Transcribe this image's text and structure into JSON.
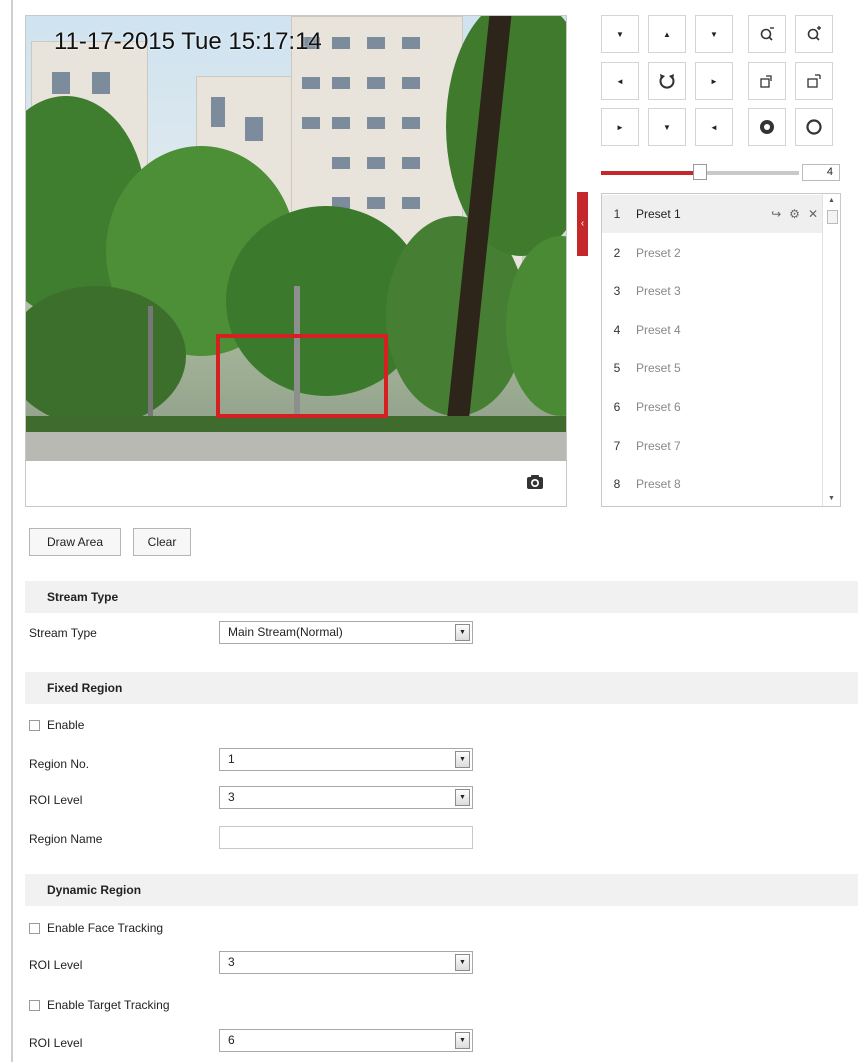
{
  "video": {
    "osd_text": "11-17-2015 Tue 15:17:14",
    "snapshot_icon": "camera-icon"
  },
  "ptz": {
    "buttons": [
      {
        "name": "pan-up-left-button",
        "icon": "arrow-up-left-icon",
        "glyph": "▼"
      },
      {
        "name": "pan-up-button",
        "icon": "arrow-up-icon",
        "glyph": "▲"
      },
      {
        "name": "pan-up-right-button",
        "icon": "arrow-up-right-icon",
        "glyph": "▼"
      },
      {
        "name": "zoom-out-button",
        "icon": "zoom-out-icon",
        "glyph": ""
      },
      {
        "name": "zoom-in-button",
        "icon": "zoom-in-icon",
        "glyph": ""
      },
      {
        "name": "pan-left-button",
        "icon": "arrow-left-icon",
        "glyph": "◄"
      },
      {
        "name": "auto-pan-button",
        "icon": "rotate-icon",
        "glyph": ""
      },
      {
        "name": "pan-right-button",
        "icon": "arrow-right-icon",
        "glyph": "►"
      },
      {
        "name": "focus-near-button",
        "icon": "focus-near-icon",
        "glyph": ""
      },
      {
        "name": "focus-far-button",
        "icon": "focus-far-icon",
        "glyph": ""
      },
      {
        "name": "pan-down-left-button",
        "icon": "arrow-down-left-icon",
        "glyph": "►"
      },
      {
        "name": "pan-down-button",
        "icon": "arrow-down-icon",
        "glyph": "▼"
      },
      {
        "name": "pan-down-right-button",
        "icon": "arrow-down-right-icon",
        "glyph": "◄"
      },
      {
        "name": "iris-open-button",
        "icon": "iris-open-icon",
        "glyph": ""
      },
      {
        "name": "iris-close-button",
        "icon": "iris-close-icon",
        "glyph": ""
      }
    ],
    "speed": {
      "value": "4",
      "level": 0.5
    }
  },
  "presets": {
    "items": [
      {
        "num": "1",
        "name": "Preset 1"
      },
      {
        "num": "2",
        "name": "Preset 2"
      },
      {
        "num": "3",
        "name": "Preset 3"
      },
      {
        "num": "4",
        "name": "Preset 4"
      },
      {
        "num": "5",
        "name": "Preset 5"
      },
      {
        "num": "6",
        "name": "Preset 6"
      },
      {
        "num": "7",
        "name": "Preset 7"
      },
      {
        "num": "8",
        "name": "Preset 8"
      }
    ],
    "active_actions": [
      "call-preset-icon",
      "gear-icon",
      "close-icon"
    ]
  },
  "roi_buttons": {
    "draw_area": "Draw Area",
    "clear": "Clear"
  },
  "stream_type": {
    "header": "Stream Type",
    "label": "Stream Type",
    "value": "Main Stream(Normal)"
  },
  "fixed_region": {
    "header": "Fixed Region",
    "enable_label": "Enable",
    "region_no_label": "Region No.",
    "region_no_value": "1",
    "roi_level_label": "ROI Level",
    "roi_level_value": "3",
    "region_name_label": "Region Name",
    "region_name_value": ""
  },
  "dynamic_region": {
    "header": "Dynamic Region",
    "face_tracking_label": "Enable Face Tracking",
    "face_roi_level_label": "ROI Level",
    "face_roi_level_value": "3",
    "target_tracking_label": "Enable Target Tracking",
    "target_roi_level_label": "ROI Level",
    "target_roi_level_value": "6"
  },
  "colors": {
    "accent": "#c4282c",
    "roi_rect": "#d42020",
    "section_bg": "#f1f1f1"
  }
}
